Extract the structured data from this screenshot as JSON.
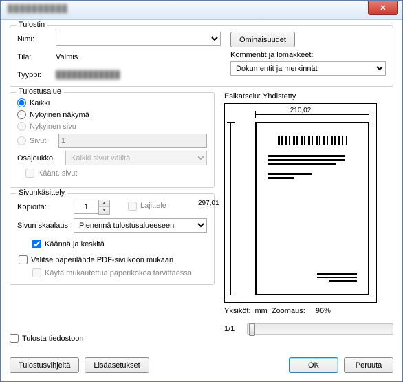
{
  "titlebar": {
    "title": "Tulosta"
  },
  "printer": {
    "legend": "Tulostin",
    "name_label": "Nimi:",
    "name_value": "",
    "properties_btn": "Ominaisuudet",
    "status_label": "Tila:",
    "status_value": "Valmis",
    "type_label": "Tyyppi:",
    "type_value": "",
    "comments_label": "Kommentit ja lomakkeet:",
    "comments_value": "Dokumentit ja merkinnät"
  },
  "range": {
    "legend": "Tulostusalue",
    "all": "Kaikki",
    "current_view": "Nykyinen näkymä",
    "current_page": "Nykyinen sivu",
    "pages": "Sivut",
    "pages_value": "1",
    "subset_label": "Osajoukko:",
    "subset_value": "Kaikki sivut väliltä",
    "reverse": "Käänt. sivut"
  },
  "handling": {
    "legend": "Sivunkäsittely",
    "copies_label": "Kopioita:",
    "copies_value": "1",
    "collate": "Lajittele",
    "scaling_label": "Sivun skaalaus:",
    "scaling_value": "Pienennä tulostusalueeseen",
    "rotate": "Käännä ja keskitä",
    "paper_source": "Valitse paperilähde PDF-sivukoon mukaan",
    "custom_paper": "Käytä mukautettua paperikokoa tarvittaessa"
  },
  "print_to_file": "Tulosta tiedostoon",
  "preview": {
    "label": "Esikatselu: Yhdistetty",
    "width": "210,02",
    "height": "297,01",
    "units_label": "Yksiköt:",
    "units_value": "mm",
    "zoom_label": "Zoomaus:",
    "zoom_value": "96%",
    "page_count": "1/1"
  },
  "buttons": {
    "tips": "Tulostusvihjeitä",
    "advanced": "Lisäasetukset",
    "ok": "OK",
    "cancel": "Peruuta"
  }
}
